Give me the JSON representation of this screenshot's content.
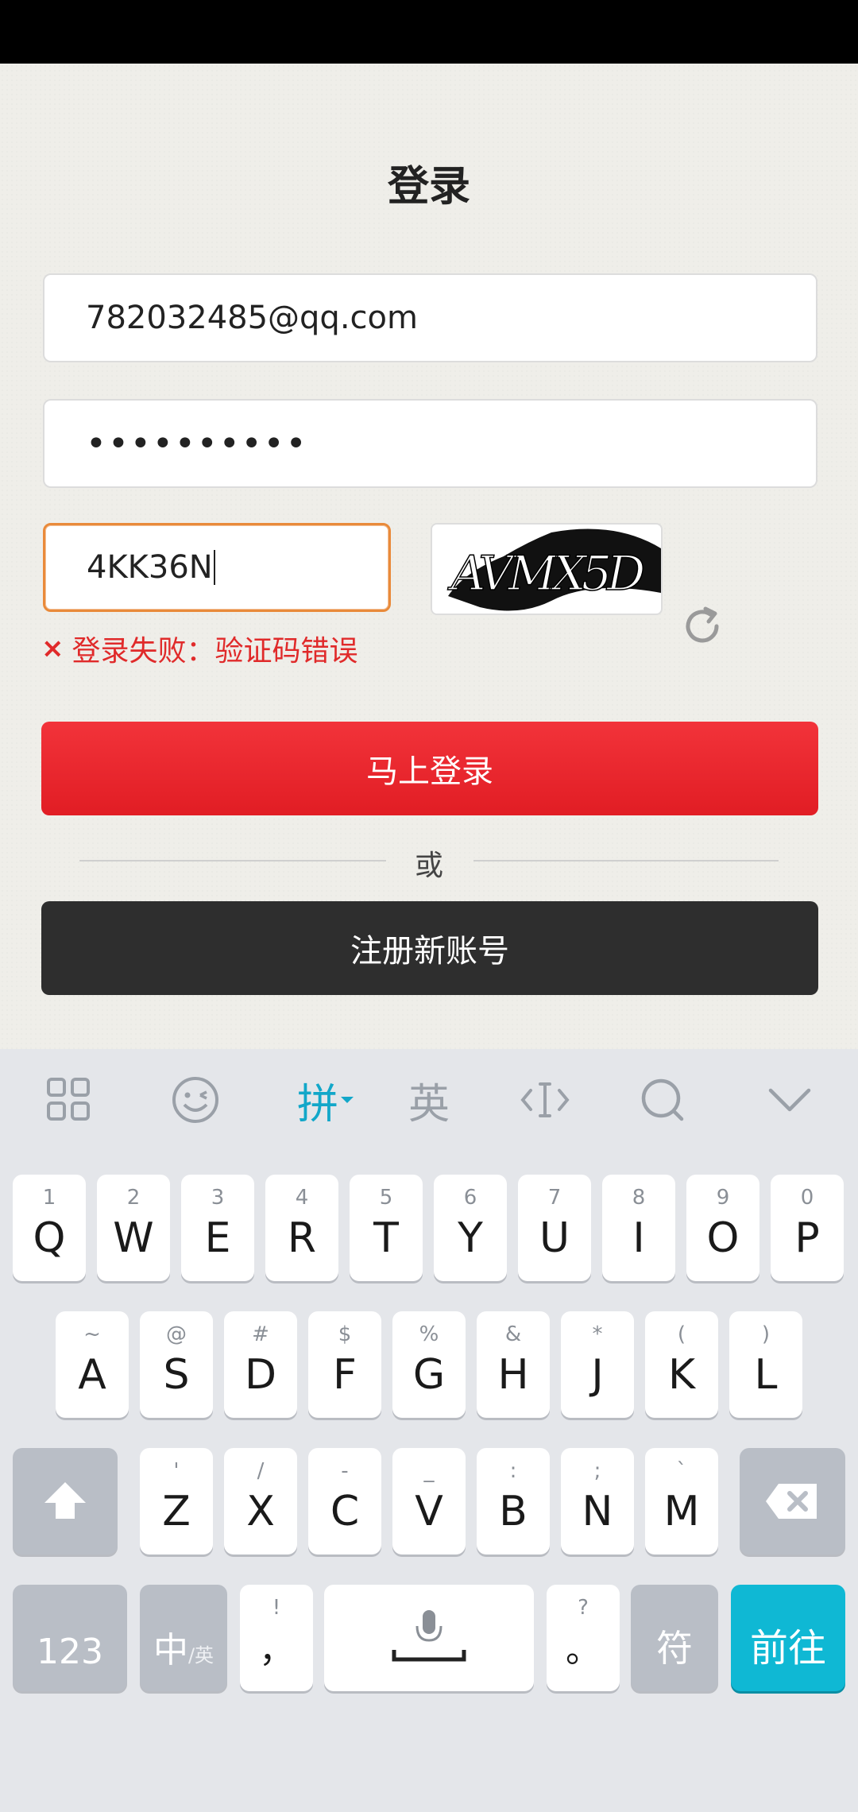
{
  "page": {
    "title": "登录",
    "email_value": "782032485@qq.com",
    "password_mask": "••••••••••",
    "captcha_input_value": "4KK36N",
    "captcha_image_text": "AVMX5D",
    "error_icon": "×",
    "error_message": "登录失败：验证码错误",
    "login_button": "马上登录",
    "or_label": "或",
    "register_button": "注册新账号",
    "colors": {
      "accent_red": "#e11d24",
      "error": "#e02a2a",
      "keyboard_accent": "#0fb8d4"
    }
  },
  "keyboard": {
    "toolbar": {
      "pinyin": "拼",
      "english": "英",
      "icons": [
        "grid-icon",
        "emoji-icon",
        "cursor-icon",
        "search-icon",
        "collapse-icon"
      ]
    },
    "row1": [
      {
        "hint": "1",
        "label": "Q"
      },
      {
        "hint": "2",
        "label": "W"
      },
      {
        "hint": "3",
        "label": "E"
      },
      {
        "hint": "4",
        "label": "R"
      },
      {
        "hint": "5",
        "label": "T"
      },
      {
        "hint": "6",
        "label": "Y"
      },
      {
        "hint": "7",
        "label": "U"
      },
      {
        "hint": "8",
        "label": "I"
      },
      {
        "hint": "9",
        "label": "O"
      },
      {
        "hint": "0",
        "label": "P"
      }
    ],
    "row2": [
      {
        "hint": "~",
        "label": "A"
      },
      {
        "hint": "@",
        "label": "S"
      },
      {
        "hint": "#",
        "label": "D"
      },
      {
        "hint": "$",
        "label": "F"
      },
      {
        "hint": "%",
        "label": "G"
      },
      {
        "hint": "&",
        "label": "H"
      },
      {
        "hint": "*",
        "label": "J"
      },
      {
        "hint": "(",
        "label": "K"
      },
      {
        "hint": ")",
        "label": "L"
      }
    ],
    "row3": [
      {
        "hint": "'",
        "label": "Z"
      },
      {
        "hint": "/",
        "label": "X"
      },
      {
        "hint": "-",
        "label": "C"
      },
      {
        "hint": "_",
        "label": "V"
      },
      {
        "hint": ":",
        "label": "B"
      },
      {
        "hint": ";",
        "label": "N"
      },
      {
        "hint": "`",
        "label": "M"
      }
    ],
    "bottom": {
      "numbers": "123",
      "lang_main": "中",
      "lang_sub": "/英",
      "comma_hint": "!",
      "comma": "，",
      "period_hint": "?",
      "period": "。",
      "symbols": "符",
      "go": "前往"
    }
  }
}
